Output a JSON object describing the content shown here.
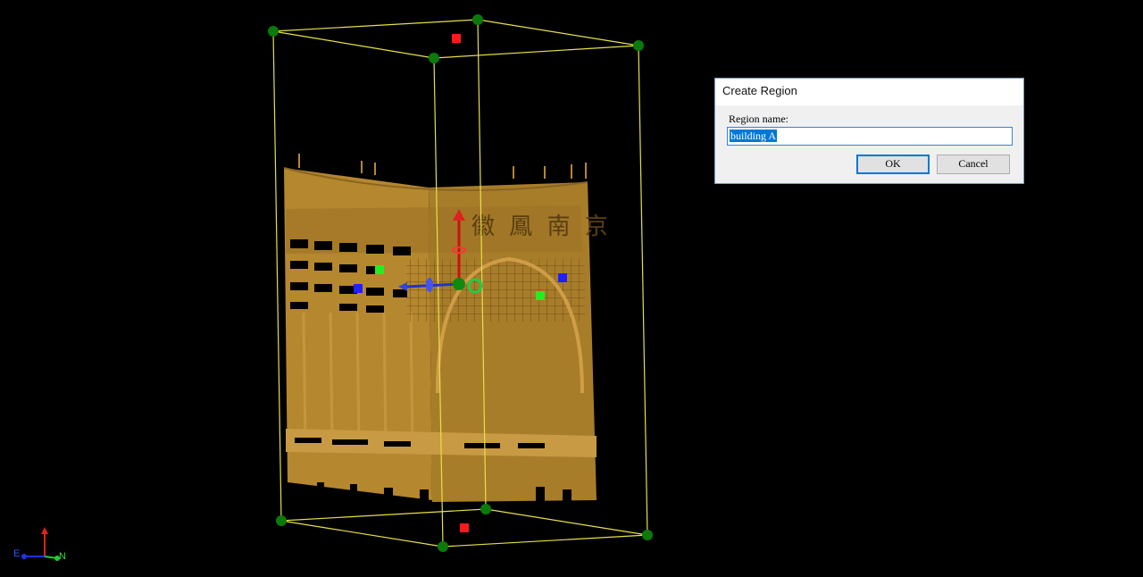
{
  "dialog": {
    "title": "Create Region",
    "label": "Region name:",
    "input_value": "building A",
    "ok_label": "OK",
    "cancel_label": "Cancel"
  },
  "viewport": {
    "signage_text": "徽 鳳 南 京",
    "point_cloud_color": "#b5872e",
    "box_edge_color": "#e6e04a",
    "vertex_handle_color": "#0b7a0b"
  },
  "axes_indicator": {
    "left_label": "E",
    "right_label": "N"
  }
}
